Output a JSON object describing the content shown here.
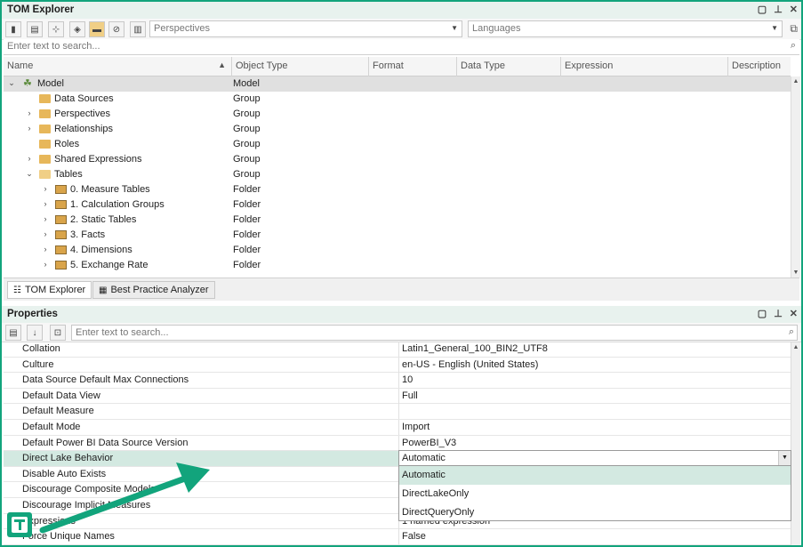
{
  "tom": {
    "title": "TOM Explorer",
    "perspectives_placeholder": "Perspectives",
    "languages_placeholder": "Languages",
    "search_placeholder": "Enter text to search...",
    "columns": [
      "Name",
      "Object Type",
      "Format",
      "Data Type",
      "Expression",
      "Description"
    ],
    "rows": [
      {
        "name": "Model",
        "type": "Model"
      },
      {
        "name": "Data Sources",
        "type": "Group"
      },
      {
        "name": "Perspectives",
        "type": "Group"
      },
      {
        "name": "Relationships",
        "type": "Group"
      },
      {
        "name": "Roles",
        "type": "Group"
      },
      {
        "name": "Shared Expressions",
        "type": "Group"
      },
      {
        "name": "Tables",
        "type": "Group"
      },
      {
        "name": "0. Measure Tables",
        "type": "Folder"
      },
      {
        "name": "1. Calculation Groups",
        "type": "Folder"
      },
      {
        "name": "2. Static Tables",
        "type": "Folder"
      },
      {
        "name": "3. Facts",
        "type": "Folder"
      },
      {
        "name": "4. Dimensions",
        "type": "Folder"
      },
      {
        "name": "5. Exchange Rate",
        "type": "Folder"
      }
    ],
    "tabs": [
      "TOM Explorer",
      "Best Practice Analyzer"
    ]
  },
  "props": {
    "title": "Properties",
    "search_placeholder": "Enter text to search...",
    "rows": [
      {
        "name": "Collation",
        "value": "Latin1_General_100_BIN2_UTF8"
      },
      {
        "name": "Culture",
        "value": "en-US - English (United States)"
      },
      {
        "name": "Data Source Default Max Connections",
        "value": "10"
      },
      {
        "name": "Default Data View",
        "value": "Full"
      },
      {
        "name": "Default Measure",
        "value": ""
      },
      {
        "name": "Default Mode",
        "value": "Import"
      },
      {
        "name": "Default Power BI Data Source Version",
        "value": "PowerBI_V3"
      },
      {
        "name": "Direct Lake Behavior",
        "value": "Automatic"
      },
      {
        "name": "Disable Auto Exists",
        "value": ""
      },
      {
        "name": "Discourage Composite Models",
        "value": ""
      },
      {
        "name": "Discourage Implicit Measures",
        "value": ""
      },
      {
        "name": "Expressions",
        "value": "1 named expression"
      },
      {
        "name": "Force Unique Names",
        "value": "False"
      }
    ],
    "dropdown_options": [
      "Automatic",
      "DirectLakeOnly",
      "DirectQueryOnly"
    ]
  },
  "colors": {
    "accent": "#12a47c",
    "highlight": "#d3e9e1"
  }
}
